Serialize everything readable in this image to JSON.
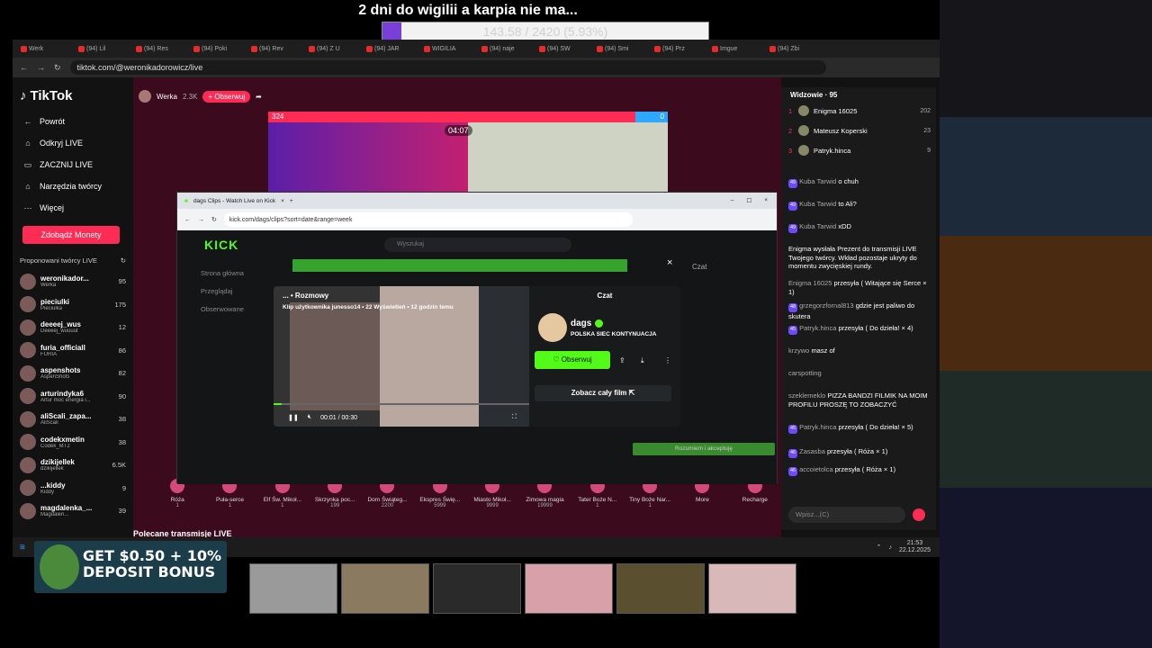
{
  "overlay": {
    "title": "2 dni do wigilii a karpia nie ma...",
    "goal_text": "143.58 / 2420 (5.93%)",
    "goal_percent": 5.93
  },
  "browser": {
    "tabs": [
      "Werk",
      "(94) Lil",
      "(94) Res",
      "(94) Poki",
      "(94) Rev",
      "(94) Z U",
      "(94) JAR",
      "WIGILIA",
      "(94) naje",
      "(94) SW",
      "(94) Smi",
      "(94) Prz",
      "Imgue",
      "(94) Zbi"
    ],
    "url": "tiktok.com/@weronikadorowicz/live"
  },
  "tiktok": {
    "logo": "TikTok",
    "nav": [
      {
        "icon": "←",
        "label": "Powrót"
      },
      {
        "icon": "⌂",
        "label": "Odkryj LIVE"
      },
      {
        "icon": "▭",
        "label": "ZACZNIJ LIVE"
      },
      {
        "icon": "⌂",
        "label": "Narzędzia twórcy"
      },
      {
        "icon": "⋯",
        "label": "Więcej"
      }
    ],
    "coins_button": "Zdobądź Monety",
    "suggested_heading": "Proponowani twórcy LIVE",
    "creators": [
      {
        "name": "weronikador...",
        "sub": "Werka",
        "count": "95"
      },
      {
        "name": "pieciulki",
        "sub": "Pieciulka",
        "count": "175"
      },
      {
        "name": "deeeej_wus",
        "sub": "Deeeej_wuuuut",
        "count": "12"
      },
      {
        "name": "furia_officiall",
        "sub": "FURIA",
        "count": "86"
      },
      {
        "name": "aspenshots",
        "sub": "AspenShots",
        "count": "82"
      },
      {
        "name": "arturindyka6",
        "sub": "Artur moc energia i...",
        "count": "90"
      },
      {
        "name": "aliScali_zapa...",
        "sub": "AliScali",
        "count": "38"
      },
      {
        "name": "codekxmetin",
        "sub": "Codek_MT2",
        "count": "38"
      },
      {
        "name": "dzikijellek",
        "sub": "dzikijellek",
        "count": "6.5K"
      },
      {
        "name": "...kiddy",
        "sub": "Kiddy",
        "count": "9"
      },
      {
        "name": "magdalenka_...",
        "sub": "Magdalen...",
        "count": "39"
      }
    ],
    "streamer": {
      "name": "Werka",
      "viewers": "2.3K",
      "follow": "+ Obserwuj"
    },
    "battle": {
      "left_score": "324",
      "right_score": "0",
      "timer": "04:07"
    },
    "gifts": [
      {
        "name": "Róża",
        "price": "1"
      },
      {
        "name": "Puła-serce",
        "price": "1"
      },
      {
        "name": "Elf Św. Mikoł...",
        "price": "1"
      },
      {
        "name": "Skrzynka poc...",
        "price": "199"
      },
      {
        "name": "Dom Świąteg...",
        "price": "2200"
      },
      {
        "name": "Ekspres Świę...",
        "price": "5999"
      },
      {
        "name": "Miasto Mikoł...",
        "price": "9999"
      },
      {
        "name": "Zimowa magia",
        "price": "19999"
      },
      {
        "name": "Tater Boże N...",
        "price": "1"
      },
      {
        "name": "Tiny Boże Nar...",
        "price": "1"
      },
      {
        "name": "More",
        "price": ""
      },
      {
        "name": "Recharge",
        "price": ""
      }
    ],
    "recommended": "Polecane transmisje LIVE"
  },
  "kick": {
    "tab_title": "dags Clips - Watch Live on Kick",
    "url": "kick.com/dags/clips?sort=date&range=week",
    "logo": "KICK",
    "search_placeholder": "Wyszukaj",
    "sidebar": [
      "Strona główna",
      "Przeglądaj",
      "Obserwowane"
    ],
    "bg_chat": "Czat",
    "accept": "Rozumiem i akceptuję",
    "close": "×"
  },
  "clip": {
    "title": "... • Rozmowy",
    "subtitle": "Klip użytkownika junesso14 • 22 Wyświetleń • 12 godzin temu",
    "time": "00:01 / 00:30",
    "progress": 3,
    "chat_title": "Czat",
    "channel": "dags",
    "channel_sub": "POLSKA SIEC KONTYNUACJA",
    "follow": "♡ Obserwuj",
    "watch": "Zobacz cały film ⇱"
  },
  "chat": {
    "viewers_heading": "Widzowie · 95",
    "top": [
      {
        "rank": "1",
        "name": "Enigma 16025",
        "count": "202"
      },
      {
        "rank": "2",
        "name": "Mateusz Koperski",
        "count": "23"
      },
      {
        "rank": "3",
        "name": "Patryk.hinca",
        "count": "9"
      }
    ],
    "messages": [
      {
        "user": "Kuba Tarwid",
        "lvl": "49",
        "text": "o chuh"
      },
      {
        "user": "Kuba Tarwid",
        "lvl": "49",
        "text": "to Ali?"
      },
      {
        "user": "Kuba Tarwid",
        "lvl": "49",
        "text": "xDD"
      },
      {
        "user": "",
        "lvl": "",
        "text": "Enigma wysłała Prezent do transmisji LIVE Twojego twórcy. Wkład pozostaje ukryty do momentu zwycięskiej rundy."
      },
      {
        "user": "Enigma 16025",
        "lvl": "",
        "text": "przesyła ( Witające się Serce × 1)"
      },
      {
        "user": "grzegorzfornal813",
        "lvl": "48",
        "text": "gdzie jest paliwo do skutera"
      },
      {
        "user": "Patryk.hinca",
        "lvl": "45",
        "text": "przesyła ( Do dzieła! × 4)"
      },
      {
        "user": "krzywo",
        "lvl": "",
        "text": "masz of"
      },
      {
        "user": "carspotting",
        "lvl": "",
        "text": ""
      },
      {
        "user": "szeklemeklo",
        "lvl": "",
        "text": "PIZZA BANDZI FILMIK NA MOIM PROFILU PROSZĘ TO ZOBACZYĆ"
      },
      {
        "user": "Patryk.hinca",
        "lvl": "45",
        "text": "przesyła ( Do dzieła! × 5)"
      },
      {
        "user": "Zasasba",
        "lvl": "46",
        "text": "przesyła ( Róża × 1)"
      },
      {
        "user": "accoietolca",
        "lvl": "46",
        "text": "przesyła ( Róża × 1)"
      }
    ],
    "input_placeholder": "Wpisz...(C)"
  },
  "taskbar": {
    "time": "21:53",
    "date": "22.12.2025"
  },
  "ad": {
    "text": "GET $0.50 + 10% DEPOSIT BONUS"
  }
}
